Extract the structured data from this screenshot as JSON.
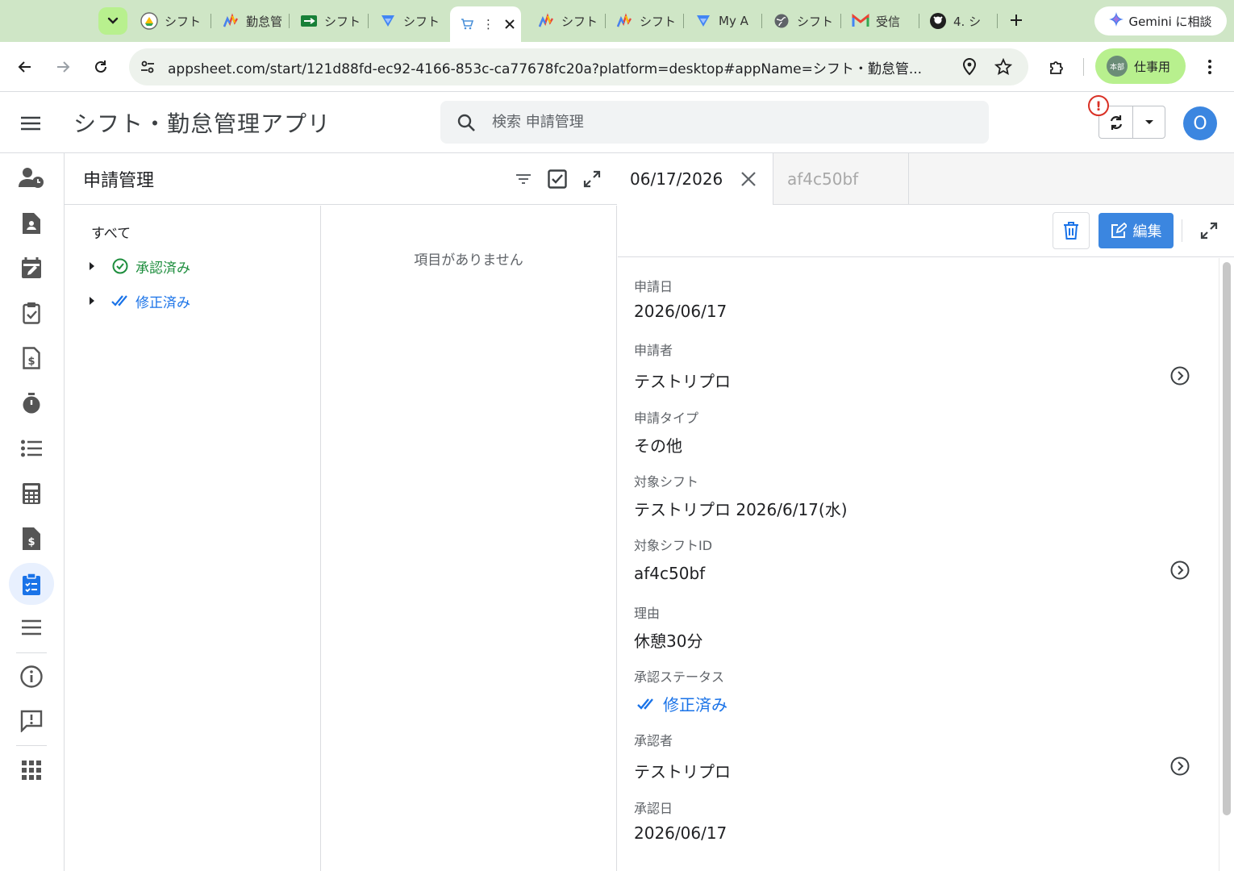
{
  "browser": {
    "tabs": [
      {
        "label": "シフト",
        "icon": "google-drive-icon"
      },
      {
        "label": "勤怠管",
        "icon": "appsheet-icon"
      },
      {
        "label": "シフト",
        "icon": "sheets-icon"
      },
      {
        "label": "シフト",
        "icon": "appsheet-blue-icon"
      },
      {
        "label": "⋮",
        "icon": "cart-icon",
        "active": true
      },
      {
        "label": "シフト",
        "icon": "appsheet-icon"
      },
      {
        "label": "シフト",
        "icon": "appsheet-icon"
      },
      {
        "label": "My A",
        "icon": "appsheet-blue-icon"
      },
      {
        "label": "シフト",
        "icon": "globe-icon"
      },
      {
        "label": "受信",
        "icon": "gmail-icon"
      },
      {
        "label": "4. シ",
        "icon": "github-icon"
      }
    ],
    "gemini_label": "Gemini に相談",
    "url": "appsheet.com/start/121d88fd-ec92-4166-853c-ca77678fc20a?platform=desktop#appName=シフト・勤怠管...",
    "profile_badge": "本部",
    "profile_label": "仕事用"
  },
  "app": {
    "title": "シフト・勤怠管理アプリ",
    "search_placeholder": "検索 申請管理",
    "avatar_letter": "O",
    "alert_mark": "!"
  },
  "panel": {
    "title": "申請管理",
    "group_all": "すべて",
    "groups": [
      {
        "label": "承認済み",
        "color": "#1e8e3e"
      },
      {
        "label": "修正済み",
        "color": "#1a73e8"
      }
    ],
    "empty_message": "項目がありません"
  },
  "detail": {
    "tab_active": "06/17/2026",
    "tab_inactive": "af4c50bf",
    "edit_label": "編集",
    "fields": [
      {
        "label": "申請日",
        "value": "2026/06/17"
      },
      {
        "label": "申請者",
        "value": "テストリプロ"
      },
      {
        "label": "申請タイプ",
        "value": "その他"
      },
      {
        "label": "対象シフト",
        "value": "テストリプロ 2026/6/17(水)"
      },
      {
        "label": "対象シフトID",
        "value": "af4c50bf"
      },
      {
        "label": "理由",
        "value": "休憩30分"
      },
      {
        "label": "承認ステータス",
        "value": "修正済み"
      },
      {
        "label": "承認者",
        "value": "テストリプロ"
      },
      {
        "label": "承認日",
        "value": "2026/06/17"
      }
    ]
  },
  "colors": {
    "accent": "#3b86e0",
    "approved": "#1e8e3e",
    "revised": "#1a73e8",
    "chrome_tabbar": "#cfe6c6"
  }
}
